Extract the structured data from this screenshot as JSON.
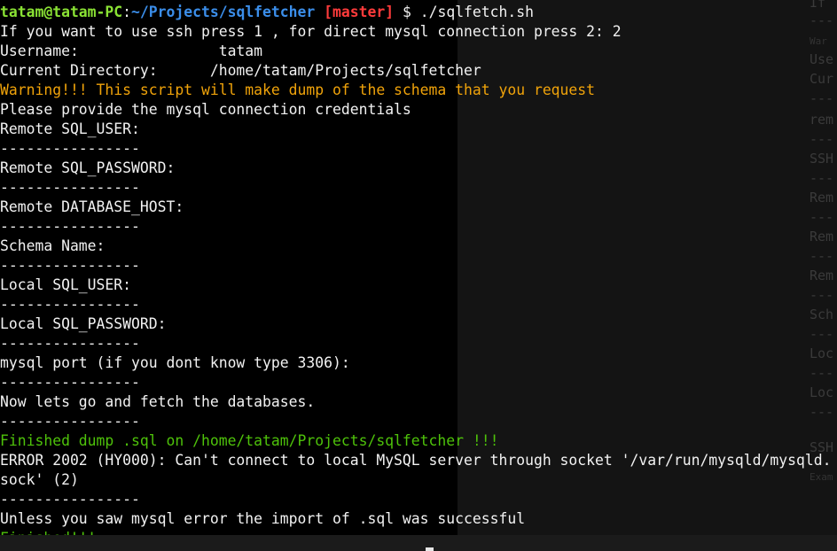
{
  "colors": {
    "background": "#000000",
    "foreground": "#f2f2f2",
    "prompt_user": "#8ae234",
    "prompt_path": "#3b8eea",
    "prompt_branch": "#ff3b3b",
    "warning": "#f0a30a",
    "success": "#4ec20a"
  },
  "prompt": {
    "user_host": "tatam@tatam-PC",
    "colon": ":",
    "path": "~/Projects/sqlfetcher",
    "branch": "[master]",
    "symbol": "$",
    "command": "./sqlfetch.sh"
  },
  "output": {
    "choice": "If you want to use ssh press 1 , for direct mysql connection press 2: 2",
    "username": "Username:                tatam",
    "current_dir": "Current Directory:      /home/tatam/Projects/sqlfetcher",
    "warning": "Warning!!! This script will make dump of the schema that you request",
    "provide_creds": "Please provide the mysql connection credentials",
    "remote_user": "Remote SQL_USER:",
    "sep1": "----------------",
    "remote_password": "Remote SQL_PASSWORD:",
    "sep2": "----------------",
    "remote_host": "Remote DATABASE_HOST:",
    "sep3": "----------------",
    "schema_name": "Schema Name:",
    "sep4": "----------------",
    "local_user": "Local SQL_USER:",
    "sep5": "----------------",
    "local_password": "Local SQL_PASSWORD:",
    "sep6": "----------------",
    "mysql_port": "mysql port (if you dont know type 3306):",
    "sep7": "----------------",
    "fetch": "Now lets go and fetch the databases.",
    "sep8": "----------------",
    "finished_dump": "Finished dump .sql on /home/tatam/Projects/sqlfetcher !!!",
    "error_line1": "ERROR 2002 (HY000): Can't connect to local MySQL server through socket '/var/run/mysqld/mysqld.",
    "error_line2": "sock' (2)",
    "sep9": "----------------",
    "import_msg": "Unless you saw mysql error the import of .sql was successful",
    "finished": "Finished!!!"
  },
  "background_window": {
    "lines": [
      "If ",
      "---",
      "War",
      "Use",
      "Cur",
      "---",
      "rem",
      "---",
      "SSH",
      "---",
      "Rem",
      "---",
      "Rem",
      "---",
      "Rem",
      "---",
      "Sch",
      "---",
      "Loc",
      "---",
      "Loc",
      "---",
      "SSH",
      "Exam"
    ]
  }
}
